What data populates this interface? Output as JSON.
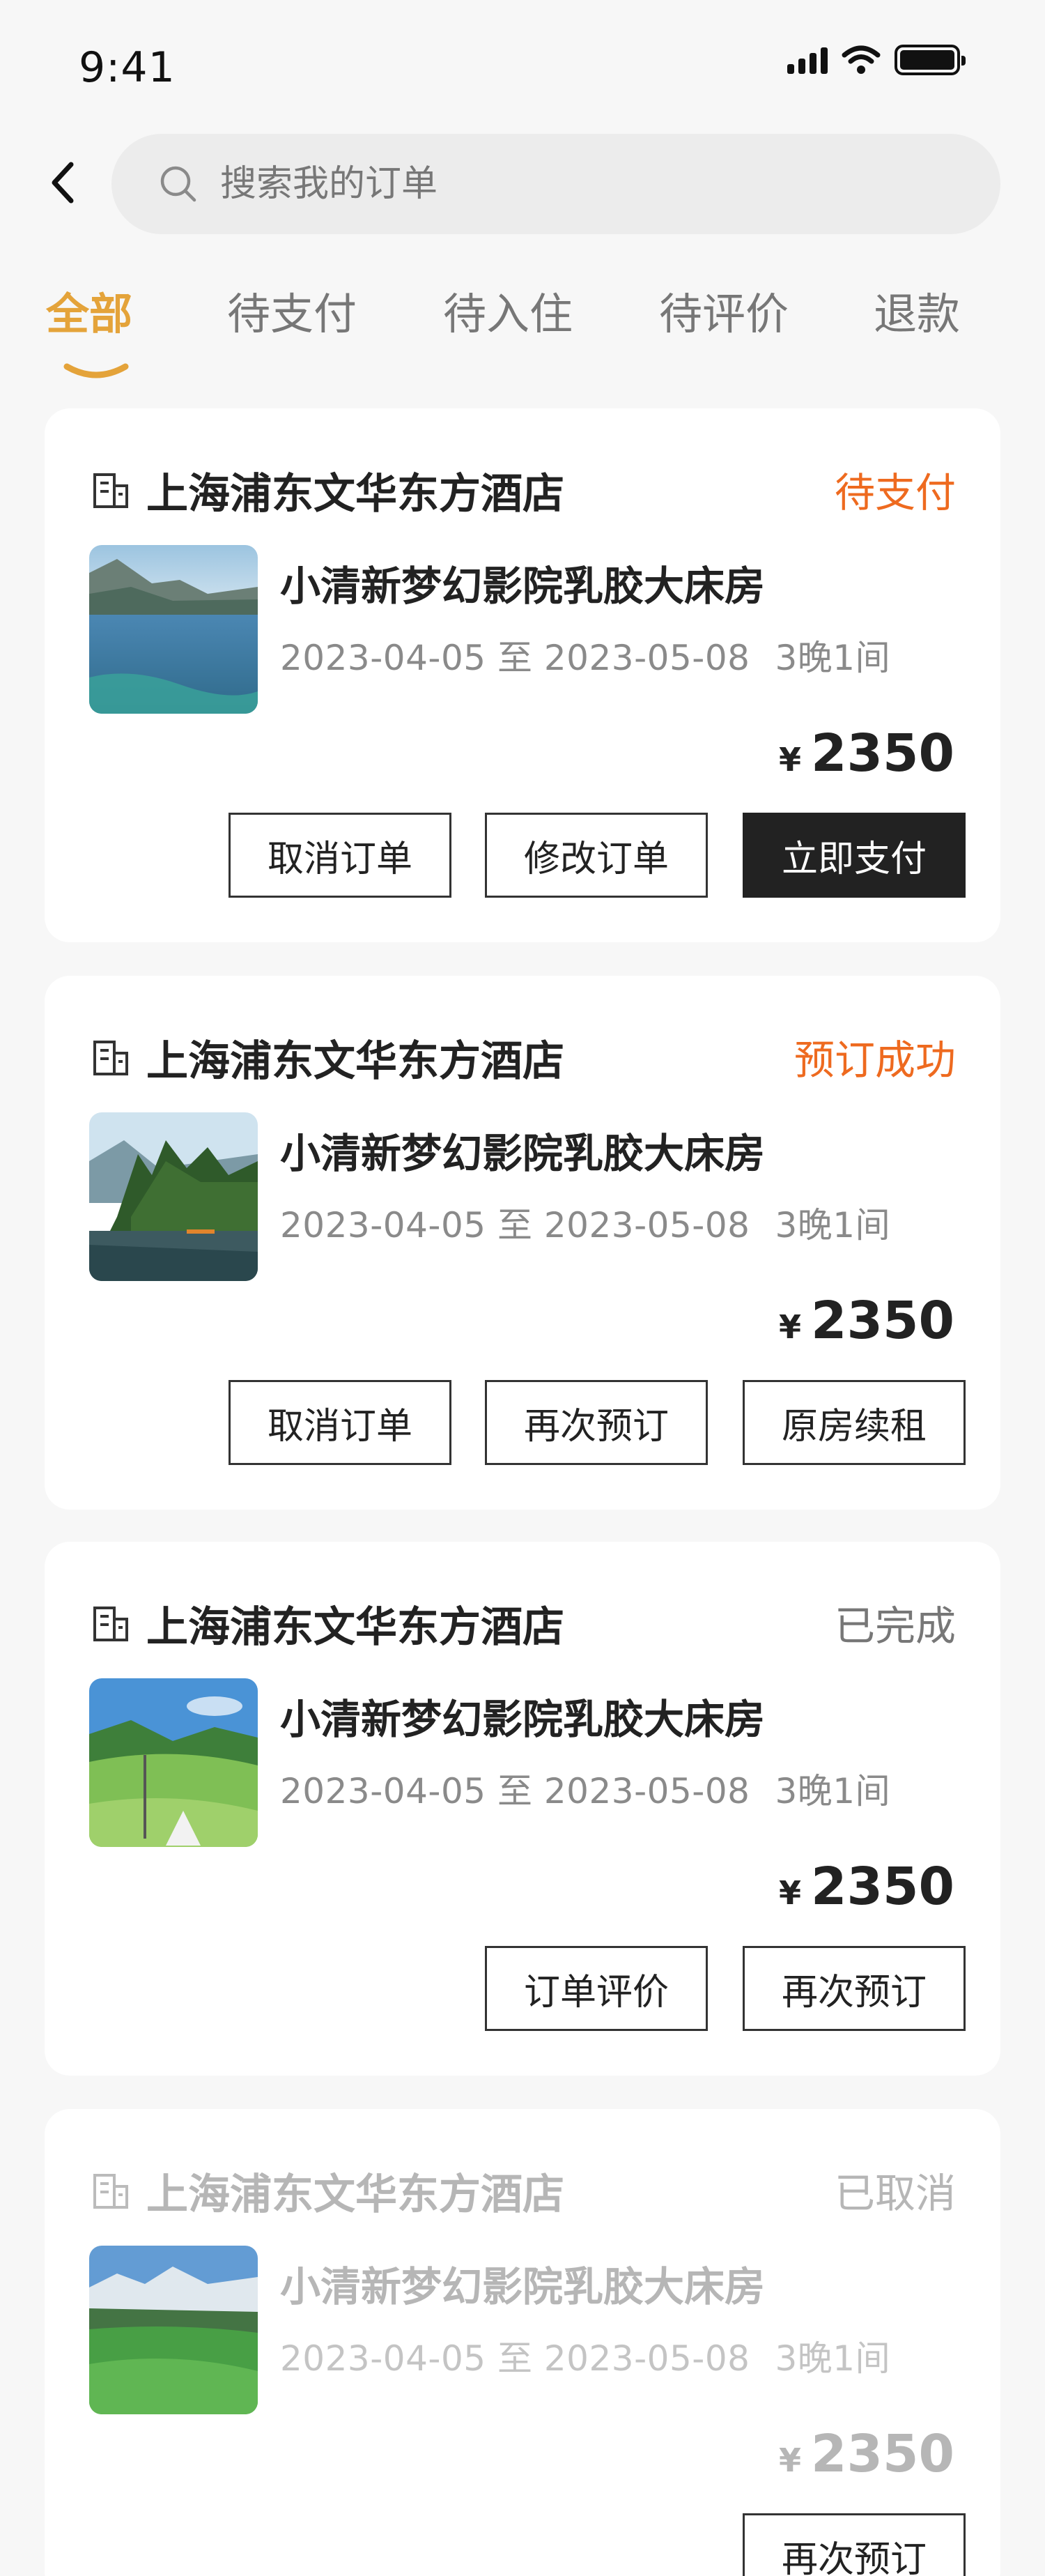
{
  "status_bar": {
    "time": "9:41"
  },
  "search": {
    "placeholder": "搜索我的订单"
  },
  "tabs": [
    {
      "label": "全部",
      "active": true
    },
    {
      "label": "待支付",
      "active": false
    },
    {
      "label": "待入住",
      "active": false
    },
    {
      "label": "待评价",
      "active": false
    },
    {
      "label": "退款",
      "active": false
    }
  ],
  "colors": {
    "accent": "#e4a33a",
    "status_orange": "#ee6a1f",
    "primary_button": "#222222"
  },
  "orders": [
    {
      "hotel": "上海浦东文华东方酒店",
      "status": "待支付",
      "room": "小清新梦幻影院乳胶大床房",
      "dates": "2023-04-05 至 2023-05-08",
      "nights": "3晚1间",
      "currency": "¥",
      "price": "2350",
      "buttons": [
        "取消订单",
        "修改订单",
        "立即支付"
      ]
    },
    {
      "hotel": "上海浦东文华东方酒店",
      "status": "预订成功",
      "room": "小清新梦幻影院乳胶大床房",
      "dates": "2023-04-05 至 2023-05-08",
      "nights": "3晚1间",
      "currency": "¥",
      "price": "2350",
      "buttons": [
        "取消订单",
        "再次预订",
        "原房续租"
      ]
    },
    {
      "hotel": "上海浦东文华东方酒店",
      "status": "已完成",
      "room": "小清新梦幻影院乳胶大床房",
      "dates": "2023-04-05 至 2023-05-08",
      "nights": "3晚1间",
      "currency": "¥",
      "price": "2350",
      "buttons": [
        "订单评价",
        "再次预订"
      ]
    },
    {
      "hotel": "上海浦东文华东方酒店",
      "status": "已取消",
      "room": "小清新梦幻影院乳胶大床房",
      "dates": "2023-04-05 至 2023-05-08",
      "nights": "3晚1间",
      "currency": "¥",
      "price": "2350",
      "buttons": [
        "再次预订"
      ]
    }
  ]
}
